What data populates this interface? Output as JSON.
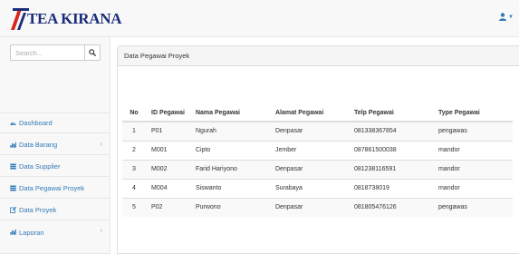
{
  "brand": {
    "name": "TEA KIRANA"
  },
  "user_menu": {
    "icon": "user-icon"
  },
  "search": {
    "placeholder": "Search..."
  },
  "sidebar": {
    "items": [
      {
        "label": "Dashboard",
        "icon": "dashboard-icon",
        "has_arrow": false
      },
      {
        "label": "Data Barang",
        "icon": "bar-chart-icon",
        "has_arrow": true
      },
      {
        "label": "Data Supplier",
        "icon": "table-icon",
        "has_arrow": false
      },
      {
        "label": "Data Pegawai Proyek",
        "icon": "table-icon",
        "has_arrow": false
      },
      {
        "label": "Data Proyek",
        "icon": "edit-icon",
        "has_arrow": false
      },
      {
        "label": "Laporan",
        "icon": "bar-chart-icon",
        "has_arrow": true
      }
    ]
  },
  "panel": {
    "heading": "Data Pegawai Proyek"
  },
  "table": {
    "headers": [
      "No",
      "ID Pegawai",
      "Nama Pegawai",
      "Alamat Pegawai",
      "Telp Pegawai",
      "Type Pegawai"
    ],
    "rows": [
      [
        "1",
        "P01",
        "Ngurah",
        "Denpasar",
        "081338367854",
        "pengawas"
      ],
      [
        "2",
        "M001",
        "Cipto",
        "Jember",
        "087861500038",
        "mandor"
      ],
      [
        "3",
        "M002",
        "Farid Hariyono",
        "Denpasar",
        "081238116591",
        "mandor"
      ],
      [
        "4",
        "M004",
        "Siswanto",
        "Surabaya",
        "0818738019",
        "mandor"
      ],
      [
        "5",
        "P02",
        "Purwono",
        "Denpasar",
        "081805476126",
        "pengawas"
      ]
    ]
  },
  "colors": {
    "link": "#337ab7",
    "brand": "#1b2d7a",
    "logo_red": "#d9261c"
  }
}
